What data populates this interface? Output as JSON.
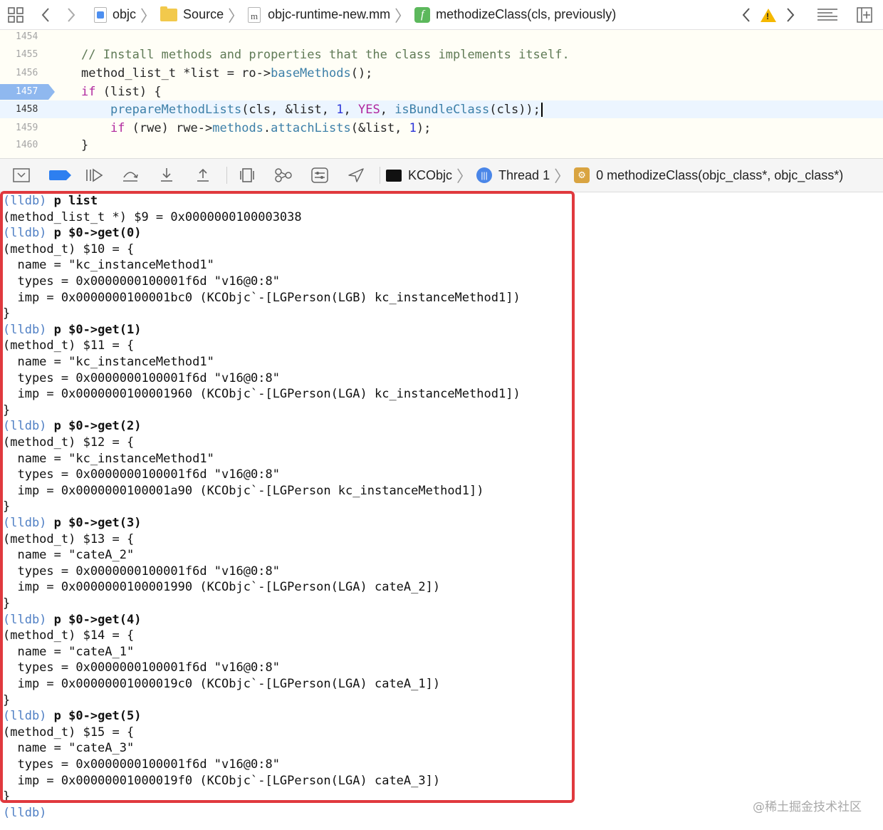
{
  "jumpbar": {
    "crumbs": [
      "objc",
      "Source",
      "objc-runtime-new.mm",
      "methodizeClass(cls, previously)"
    ]
  },
  "editor": {
    "lines": [
      {
        "num": "1454",
        "code": ""
      },
      {
        "num": "1455",
        "code": "// Install methods and properties that the class implements itself."
      },
      {
        "num": "1456",
        "code": "method_list_t *list = ro->baseMethods();"
      },
      {
        "num": "1457",
        "code": "if (list) {"
      },
      {
        "num": "1458",
        "code": "    prepareMethodLists(cls, &list, 1, YES, isBundleClass(cls));"
      },
      {
        "num": "1459",
        "code": "    if (rwe) rwe->methods.attachLists(&list, 1);"
      },
      {
        "num": "1460",
        "code": "}"
      }
    ]
  },
  "debugbar": {
    "process": "KCObjc",
    "thread": "Thread 1",
    "frame": "0 methodizeClass(objc_class*, objc_class*)"
  },
  "console": {
    "lines": [
      {
        "prompt": "(lldb)",
        "text": " p list",
        "cmd": true
      },
      {
        "prompt": "",
        "text": "(method_list_t *) $9 = 0x0000000100003038"
      },
      {
        "prompt": "(lldb)",
        "text": " p $0->get(0)",
        "cmd": true
      },
      {
        "prompt": "",
        "text": "(method_t) $10 = {"
      },
      {
        "prompt": "",
        "text": "  name = \"kc_instanceMethod1\""
      },
      {
        "prompt": "",
        "text": "  types = 0x0000000100001f6d \"v16@0:8\""
      },
      {
        "prompt": "",
        "text": "  imp = 0x0000000100001bc0 (KCObjc`-[LGPerson(LGB) kc_instanceMethod1])"
      },
      {
        "prompt": "",
        "text": "}"
      },
      {
        "prompt": "(lldb)",
        "text": " p $0->get(1)",
        "cmd": true
      },
      {
        "prompt": "",
        "text": "(method_t) $11 = {"
      },
      {
        "prompt": "",
        "text": "  name = \"kc_instanceMethod1\""
      },
      {
        "prompt": "",
        "text": "  types = 0x0000000100001f6d \"v16@0:8\""
      },
      {
        "prompt": "",
        "text": "  imp = 0x0000000100001960 (KCObjc`-[LGPerson(LGA) kc_instanceMethod1])"
      },
      {
        "prompt": "",
        "text": "}"
      },
      {
        "prompt": "(lldb)",
        "text": " p $0->get(2)",
        "cmd": true
      },
      {
        "prompt": "",
        "text": "(method_t) $12 = {"
      },
      {
        "prompt": "",
        "text": "  name = \"kc_instanceMethod1\""
      },
      {
        "prompt": "",
        "text": "  types = 0x0000000100001f6d \"v16@0:8\""
      },
      {
        "prompt": "",
        "text": "  imp = 0x0000000100001a90 (KCObjc`-[LGPerson kc_instanceMethod1])"
      },
      {
        "prompt": "",
        "text": "}"
      },
      {
        "prompt": "(lldb)",
        "text": " p $0->get(3)",
        "cmd": true
      },
      {
        "prompt": "",
        "text": "(method_t) $13 = {"
      },
      {
        "prompt": "",
        "text": "  name = \"cateA_2\""
      },
      {
        "prompt": "",
        "text": "  types = 0x0000000100001f6d \"v16@0:8\""
      },
      {
        "prompt": "",
        "text": "  imp = 0x0000000100001990 (KCObjc`-[LGPerson(LGA) cateA_2])"
      },
      {
        "prompt": "",
        "text": "}"
      },
      {
        "prompt": "(lldb)",
        "text": " p $0->get(4)",
        "cmd": true
      },
      {
        "prompt": "",
        "text": "(method_t) $14 = {"
      },
      {
        "prompt": "",
        "text": "  name = \"cateA_1\""
      },
      {
        "prompt": "",
        "text": "  types = 0x0000000100001f6d \"v16@0:8\""
      },
      {
        "prompt": "",
        "text": "  imp = 0x00000001000019c0 (KCObjc`-[LGPerson(LGA) cateA_1])"
      },
      {
        "prompt": "",
        "text": "}"
      },
      {
        "prompt": "(lldb)",
        "text": " p $0->get(5)",
        "cmd": true
      },
      {
        "prompt": "",
        "text": "(method_t) $15 = {"
      },
      {
        "prompt": "",
        "text": "  name = \"cateA_3\""
      },
      {
        "prompt": "",
        "text": "  types = 0x0000000100001f6d \"v16@0:8\""
      },
      {
        "prompt": "",
        "text": "  imp = 0x00000001000019f0 (KCObjc`-[LGPerson(LGA) cateA_3])"
      },
      {
        "prompt": "",
        "text": "}"
      },
      {
        "prompt": "(lldb)",
        "text": ""
      }
    ]
  },
  "watermark": "@稀土掘金技术社区"
}
